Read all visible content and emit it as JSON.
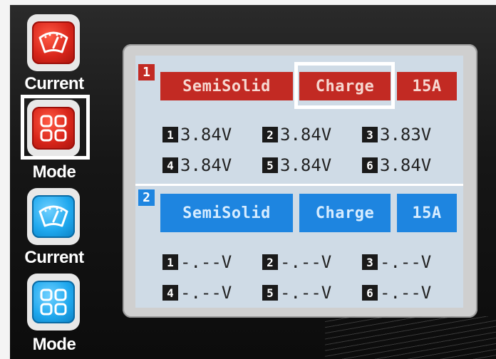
{
  "buttons": {
    "current1_label": "Current",
    "mode1_label": "Mode",
    "current2_label": "Current",
    "mode2_label": "Mode"
  },
  "channel1": {
    "number": "1",
    "battery_type": "SemiSolid",
    "mode": "Charge",
    "current": "15A",
    "cells": [
      {
        "index": "1",
        "voltage": "3.84V"
      },
      {
        "index": "2",
        "voltage": "3.84V"
      },
      {
        "index": "3",
        "voltage": "3.83V"
      },
      {
        "index": "4",
        "voltage": "3.84V"
      },
      {
        "index": "5",
        "voltage": "3.84V"
      },
      {
        "index": "6",
        "voltage": "3.84V"
      }
    ]
  },
  "channel2": {
    "number": "2",
    "battery_type": "SemiSolid",
    "mode": "Charge",
    "current": "15A",
    "cells": [
      {
        "index": "1",
        "voltage": "-.--V"
      },
      {
        "index": "2",
        "voltage": "-.--V"
      },
      {
        "index": "3",
        "voltage": "-.--V"
      },
      {
        "index": "4",
        "voltage": "-.--V"
      },
      {
        "index": "5",
        "voltage": "-.--V"
      },
      {
        "index": "6",
        "voltage": "-.--V"
      }
    ]
  },
  "colors": {
    "channel1_accent": "#c22a23",
    "channel2_accent": "#1e85e0",
    "screen_bg": "#cfdbe6"
  },
  "icons": {
    "current": "gauge-icon",
    "mode": "four-squares-icon"
  }
}
